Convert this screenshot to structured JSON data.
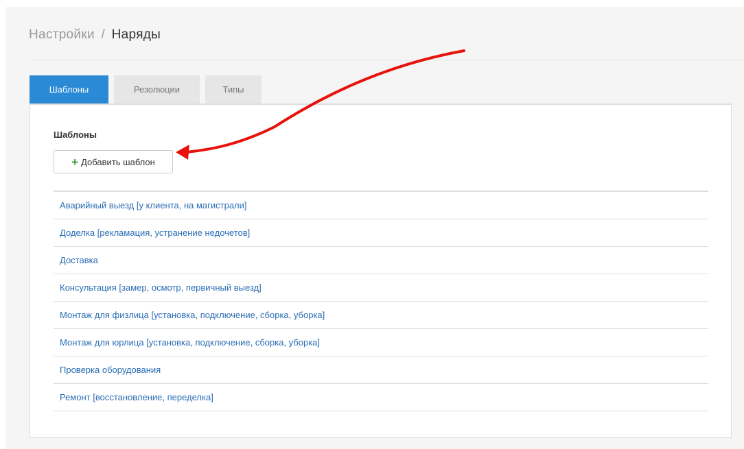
{
  "breadcrumb": {
    "parent": "Настройки",
    "separator": "/",
    "current": "Наряды"
  },
  "tabs": [
    {
      "label": "Шаблоны",
      "active": true
    },
    {
      "label": "Резолюции",
      "active": false
    },
    {
      "label": "Типы",
      "active": false
    }
  ],
  "panel": {
    "title": "Шаблоны",
    "add_button_label": "Добавить шаблон",
    "add_button_icon": "plus-icon"
  },
  "templates": [
    "Аварийный выезд [у клиента, на магистрали]",
    "Доделка [рекламация, устранение недочетов]",
    "Доставка",
    "Консультация [замер, осмотр, первичный выезд]",
    "Монтаж для физлица [установка, подключение, сборка, уборка]",
    "Монтаж для юрлица [установка, подключение, сборка, уборка]",
    "Проверка оборудования",
    "Ремонт [восстановление, переделка]"
  ],
  "colors": {
    "accent": "#2a8ad6",
    "link": "#2a6db5",
    "plus": "#3a9e3a",
    "annotation_arrow": "#e8120c"
  }
}
